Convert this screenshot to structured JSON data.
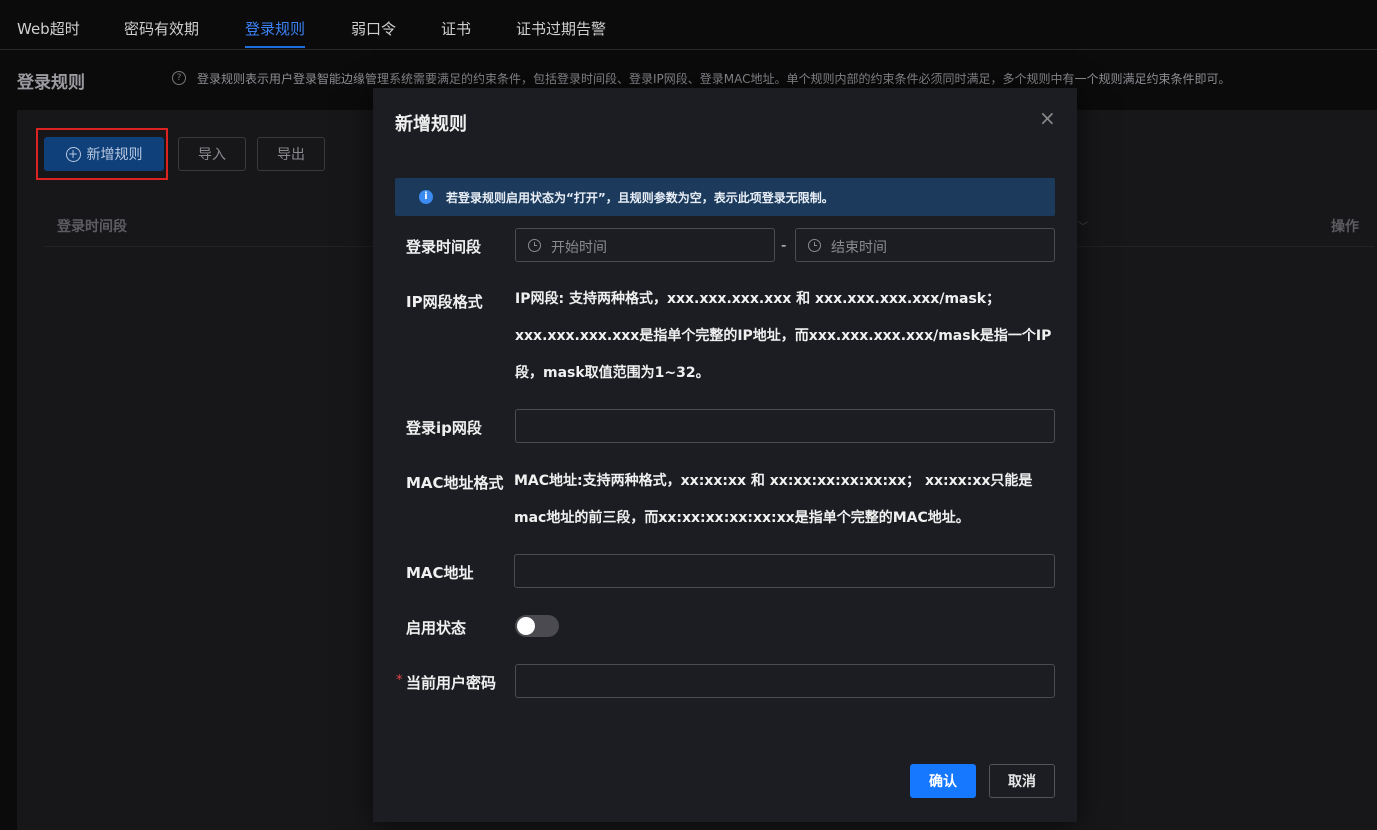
{
  "tabs": [
    {
      "label": "Web超时"
    },
    {
      "label": "密码有效期"
    },
    {
      "label": "登录规则"
    },
    {
      "label": "弱口令"
    },
    {
      "label": "证书"
    },
    {
      "label": "证书过期告警"
    }
  ],
  "page": {
    "title": "登录规则",
    "description": "登录规则表示用户登录智能边缘管理系统需要满足的约束条件，包括登录时间段、登录IP网段、登录MAC地址。单个规则内部的约束条件必须同时满足，多个规则中有一个规则满足约束条件即可。"
  },
  "toolbar": {
    "add_label": "新增规则",
    "import_label": "导入",
    "export_label": "导出"
  },
  "table": {
    "columns": [
      "登录时间段",
      "操作"
    ]
  },
  "dialog": {
    "title": "新增规则",
    "close": "×",
    "banner": "若登录规则启用状态为“打开”，且规则参数为空，表示此项登录无限制。",
    "time_label": "登录时间段",
    "start_placeholder": "开始时间",
    "end_placeholder": "结束时间",
    "separator": "-",
    "ip_format_label": "IP网段格式",
    "ip_format_text": "IP网段: 支持两种格式，xxx.xxx.xxx.xxx 和 xxx.xxx.xxx.xxx/mask； xxx.xxx.xxx.xxx是指单个完整的IP地址，而xxx.xxx.xxx.xxx/mask是指一个IP段，mask取值范围为1~32。",
    "ip_label": "登录ip网段",
    "ip_value": "",
    "mac_format_label": "MAC地址格式",
    "mac_format_text": "MAC地址:支持两种格式，xx:xx:xx 和 xx:xx:xx:xx:xx:xx； xx:xx:xx只能是mac地址的前三段，而xx:xx:xx:xx:xx:xx是指单个完整的MAC地址。",
    "mac_label": "MAC地址",
    "mac_value": "",
    "enable_label": "启用状态",
    "enable_on": false,
    "password_label": "当前用户密码",
    "password_required_mark": "*",
    "password_value": "",
    "confirm_label": "确认",
    "cancel_label": "取消"
  },
  "colors": {
    "accent": "#1677ff",
    "active_tab": "#3b82f6",
    "highlight_box": "#dd2222",
    "banner_bg": "#1b3a5c"
  }
}
